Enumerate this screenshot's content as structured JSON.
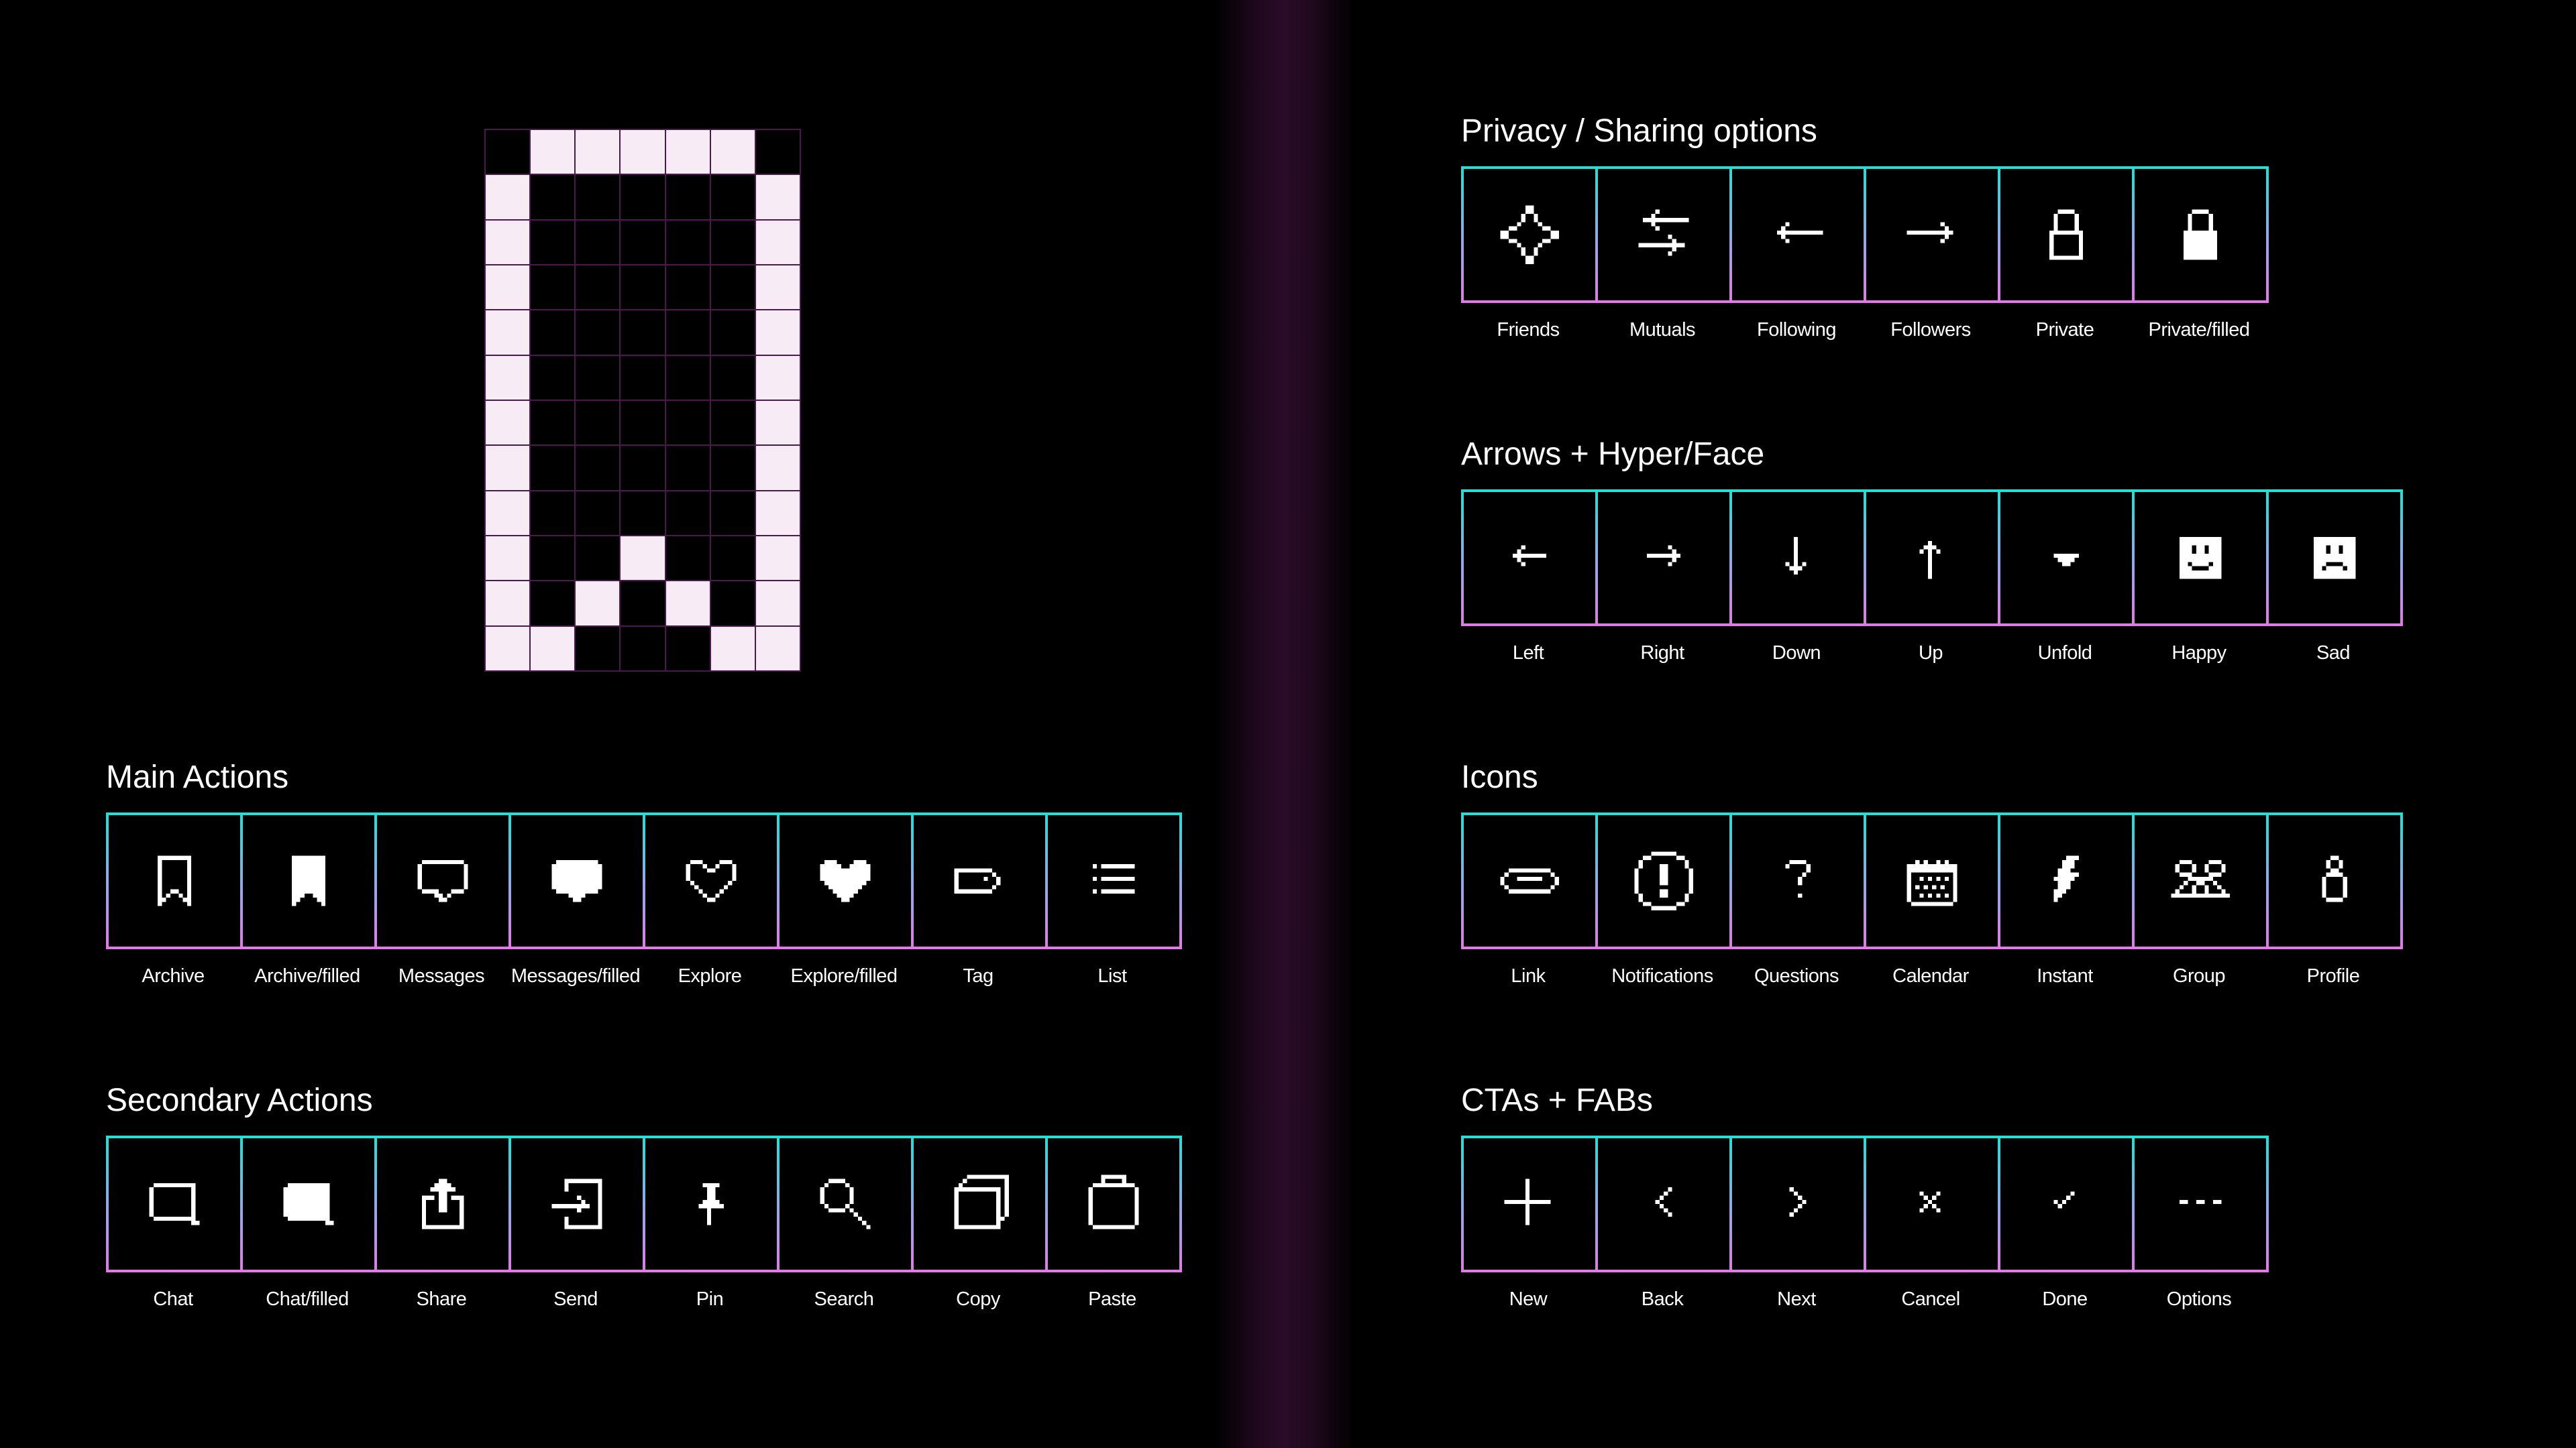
{
  "sections": {
    "main": {
      "title": "Main Actions",
      "items": [
        {
          "label": "Archive",
          "icon": "archive-icon"
        },
        {
          "label": "Archive/filled",
          "icon": "archive-filled-icon"
        },
        {
          "label": "Messages",
          "icon": "messages-icon"
        },
        {
          "label": "Messages/filled",
          "icon": "messages-filled-icon"
        },
        {
          "label": "Explore",
          "icon": "explore-icon"
        },
        {
          "label": "Explore/filled",
          "icon": "explore-filled-icon"
        },
        {
          "label": "Tag",
          "icon": "tag-icon"
        },
        {
          "label": "List",
          "icon": "list-icon"
        }
      ]
    },
    "secondary": {
      "title": "Secondary Actions",
      "items": [
        {
          "label": "Chat",
          "icon": "chat-icon"
        },
        {
          "label": "Chat/filled",
          "icon": "chat-filled-icon"
        },
        {
          "label": "Share",
          "icon": "share-icon"
        },
        {
          "label": "Send",
          "icon": "send-icon"
        },
        {
          "label": "Pin",
          "icon": "pin-icon"
        },
        {
          "label": "Search",
          "icon": "search-icon"
        },
        {
          "label": "Copy",
          "icon": "copy-icon"
        },
        {
          "label": "Paste",
          "icon": "paste-icon"
        }
      ]
    },
    "privacy": {
      "title": "Privacy / Sharing options",
      "items": [
        {
          "label": "Friends",
          "icon": "friends-sparkle-icon"
        },
        {
          "label": "Mutuals",
          "icon": "mutuals-arrows-icon"
        },
        {
          "label": "Following",
          "icon": "following-arrow-left-icon"
        },
        {
          "label": "Followers",
          "icon": "followers-arrow-right-icon"
        },
        {
          "label": "Private",
          "icon": "private-lock-icon"
        },
        {
          "label": "Private/filled",
          "icon": "private-lock-filled-icon"
        }
      ]
    },
    "arrows": {
      "title": "Arrows + Hyper/Face",
      "items": [
        {
          "label": "Left",
          "icon": "arrow-left-icon"
        },
        {
          "label": "Right",
          "icon": "arrow-right-icon"
        },
        {
          "label": "Down",
          "icon": "arrow-down-icon"
        },
        {
          "label": "Up",
          "icon": "arrow-up-icon"
        },
        {
          "label": "Unfold",
          "icon": "unfold-icon"
        },
        {
          "label": "Happy",
          "icon": "happy-face-icon"
        },
        {
          "label": "Sad",
          "icon": "sad-face-icon"
        }
      ]
    },
    "icons": {
      "title": "Icons",
      "items": [
        {
          "label": "Link",
          "icon": "link-icon"
        },
        {
          "label": "Notifications",
          "icon": "notifications-icon"
        },
        {
          "label": "Questions",
          "icon": "question-icon"
        },
        {
          "label": "Calendar",
          "icon": "calendar-icon"
        },
        {
          "label": "Instant",
          "icon": "instant-bolt-icon"
        },
        {
          "label": "Group",
          "icon": "group-icon"
        },
        {
          "label": "Profile",
          "icon": "profile-icon"
        }
      ]
    },
    "ctas": {
      "title": "CTAs + FABs",
      "items": [
        {
          "label": "New",
          "icon": "plus-icon"
        },
        {
          "label": "Back",
          "icon": "chevron-left-icon"
        },
        {
          "label": "Next",
          "icon": "chevron-right-icon"
        },
        {
          "label": "Cancel",
          "icon": "close-icon"
        },
        {
          "label": "Done",
          "icon": "check-icon"
        },
        {
          "label": "Options",
          "icon": "more-options-icon"
        }
      ]
    }
  },
  "showcase": {
    "icon": "archive-pixel-grid-icon"
  },
  "colors": {
    "background": "#000000",
    "icon_fg": "#ffffff",
    "border_top": "#22e0d6",
    "border_bottom": "#e27ae6",
    "divider_glow": "#2a0c28",
    "grid_line": "#4a1a4a",
    "pixel_on": "#f7ecf6"
  }
}
